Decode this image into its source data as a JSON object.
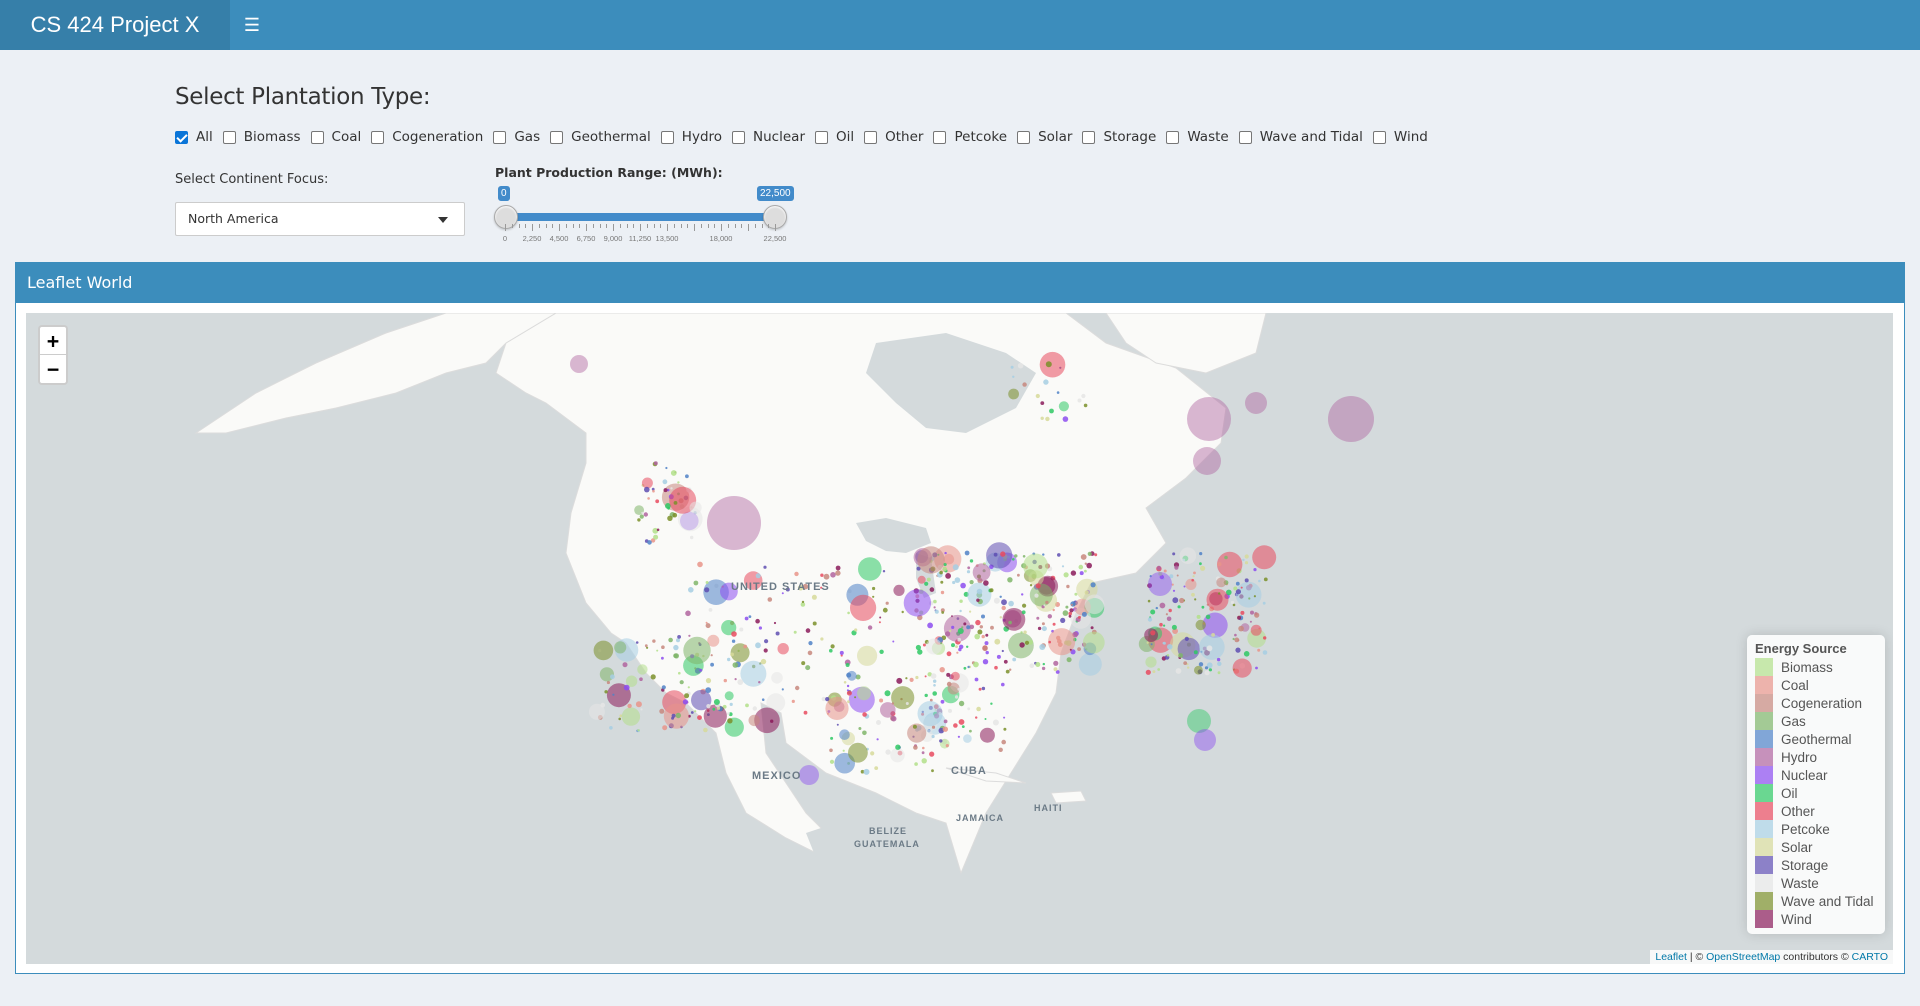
{
  "header": {
    "title": "CS 424 Project X",
    "menu_icon": "hamburger-icon"
  },
  "controls": {
    "plant_title": "Select Plantation Type:",
    "types": [
      {
        "label": "All",
        "checked": true
      },
      {
        "label": "Biomass",
        "checked": false
      },
      {
        "label": "Coal",
        "checked": false
      },
      {
        "label": "Cogeneration",
        "checked": false
      },
      {
        "label": "Gas",
        "checked": false
      },
      {
        "label": "Geothermal",
        "checked": false
      },
      {
        "label": "Hydro",
        "checked": false
      },
      {
        "label": "Nuclear",
        "checked": false
      },
      {
        "label": "Oil",
        "checked": false
      },
      {
        "label": "Other",
        "checked": false
      },
      {
        "label": "Petcoke",
        "checked": false
      },
      {
        "label": "Solar",
        "checked": false
      },
      {
        "label": "Storage",
        "checked": false
      },
      {
        "label": "Waste",
        "checked": false
      },
      {
        "label": "Wave and Tidal",
        "checked": false
      },
      {
        "label": "Wind",
        "checked": false
      }
    ],
    "continent_label": "Select Continent Focus:",
    "continent_value": "North America",
    "range_label": "Plant Production Range: (MWh):",
    "range_min": "0",
    "range_max": "22,500",
    "range_ticks": [
      "0",
      "2,250",
      "4,500",
      "6,750",
      "9,000",
      "11,250",
      "13,500",
      "18,000",
      "22,500"
    ]
  },
  "box": {
    "title": "Leaflet World"
  },
  "map": {
    "zoom_in": "+",
    "zoom_out": "−",
    "labels": {
      "us": "UNITED STATES",
      "mexico": "MEXICO",
      "cuba": "CUBA",
      "haiti": "HAITI",
      "jamaica": "JAMAICA",
      "belize": "BELIZE",
      "guatemala": "GUATEMALA"
    },
    "legend_title": "Energy Source",
    "legend": [
      {
        "label": "Biomass",
        "color": "#b2df8a"
      },
      {
        "label": "Coal",
        "color": "#e8948a"
      },
      {
        "label": "Cogeneration",
        "color": "#c7877e"
      },
      {
        "label": "Gas",
        "color": "#7fb56a"
      },
      {
        "label": "Geothermal",
        "color": "#4f81c7"
      },
      {
        "label": "Hydro",
        "color": "#b0649f"
      },
      {
        "label": "Nuclear",
        "color": "#8c4cf0"
      },
      {
        "label": "Oil",
        "color": "#2ec864"
      },
      {
        "label": "Other",
        "color": "#e84a5f"
      },
      {
        "label": "Petcoke",
        "color": "#a6cee3"
      },
      {
        "label": "Solar",
        "color": "#d6d99a"
      },
      {
        "label": "Storage",
        "color": "#5e4db2"
      },
      {
        "label": "Waste",
        "color": "#e5e5e5"
      },
      {
        "label": "Wave and Tidal",
        "color": "#7a8f2a"
      },
      {
        "label": "Wind",
        "color": "#8a1a5a"
      }
    ],
    "attribution": {
      "leaflet": "Leaflet",
      "sep": " | © ",
      "osm": "OpenStreetMap",
      "contrib": " contributors © ",
      "carto": "CARTO"
    }
  }
}
